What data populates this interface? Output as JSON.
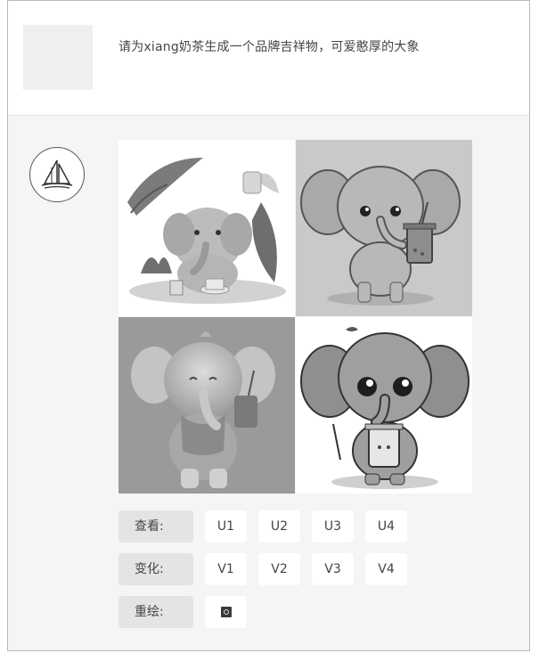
{
  "user": {
    "prompt": "请为xiang奶茶生成一个品牌吉祥物，可爱憨厚的大象"
  },
  "bot": {
    "avatar_icon": "sailboat-icon"
  },
  "result_images": [
    {
      "alt": "elephant-with-leaf-and-tea-sketch"
    },
    {
      "alt": "elephant-holding-milk-tea-cartoon"
    },
    {
      "alt": "elephant-3d-with-drink"
    },
    {
      "alt": "elephant-chibi-with-cup"
    }
  ],
  "actions": {
    "view_label": "查看:",
    "view_buttons": [
      "U1",
      "U2",
      "U3",
      "U4"
    ],
    "vary_label": "变化:",
    "vary_buttons": [
      "V1",
      "V2",
      "V3",
      "V4"
    ],
    "redo_label": "重绘:",
    "redo_icon": "reroll-icon"
  }
}
